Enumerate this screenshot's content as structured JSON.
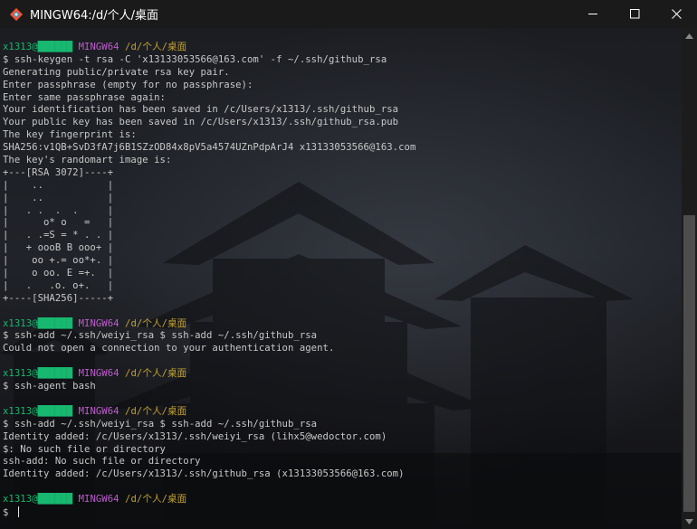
{
  "window": {
    "title": "MINGW64:/d/个人/桌面",
    "icon": "git-bash-icon",
    "controls": [
      "minimize-icon",
      "maximize-icon",
      "close-icon"
    ]
  },
  "prompt": {
    "user": "x1313@",
    "host_block": "██████",
    "mingw": "MINGW64",
    "path": "/d/个人/桌面"
  },
  "colors": {
    "user": "#17b86f",
    "mingw": "#bf5ccf",
    "path": "#c0a033",
    "text": "#c8c8c8"
  },
  "terminal": {
    "lines": [
      {
        "type": "prompt"
      },
      {
        "type": "text",
        "text": "$ ssh-keygen -t rsa -C 'x13133053566@163.com' -f ~/.ssh/github_rsa"
      },
      {
        "type": "text",
        "text": "Generating public/private rsa key pair."
      },
      {
        "type": "text",
        "text": "Enter passphrase (empty for no passphrase):"
      },
      {
        "type": "text",
        "text": "Enter same passphrase again:"
      },
      {
        "type": "text",
        "text": "Your identification has been saved in /c/Users/x1313/.ssh/github_rsa"
      },
      {
        "type": "text",
        "text": "Your public key has been saved in /c/Users/x1313/.ssh/github_rsa.pub"
      },
      {
        "type": "text",
        "text": "The key fingerprint is:"
      },
      {
        "type": "text",
        "text": "SHA256:v1QB+SvD3fA7j6B1SZzOD84x8pV5a4574UZnPdpArJ4 x13133053566@163.com"
      },
      {
        "type": "text",
        "text": "The key's randomart image is:"
      },
      {
        "type": "text",
        "text": "+---[RSA 3072]----+"
      },
      {
        "type": "text",
        "text": "|    ..           |"
      },
      {
        "type": "text",
        "text": "|    ..           |"
      },
      {
        "type": "text",
        "text": "|   . .  .  .     |"
      },
      {
        "type": "text",
        "text": "|      o* o   =   |"
      },
      {
        "type": "text",
        "text": "|   . .=S = * . . |"
      },
      {
        "type": "text",
        "text": "|   + oooB B ooo+ |"
      },
      {
        "type": "text",
        "text": "|    oo +.= oo*+. |"
      },
      {
        "type": "text",
        "text": "|    o oo. E =+.  |"
      },
      {
        "type": "text",
        "text": "|   .   .o. o+.   |"
      },
      {
        "type": "text",
        "text": "+----[SHA256]-----+"
      },
      {
        "type": "blank"
      },
      {
        "type": "prompt"
      },
      {
        "type": "text",
        "text": "$ ssh-add ~/.ssh/weiyi_rsa $ ssh-add ~/.ssh/github_rsa"
      },
      {
        "type": "text",
        "text": "Could not open a connection to your authentication agent."
      },
      {
        "type": "blank"
      },
      {
        "type": "prompt"
      },
      {
        "type": "text",
        "text": "$ ssh-agent bash"
      },
      {
        "type": "blank"
      },
      {
        "type": "prompt"
      },
      {
        "type": "text",
        "text": "$ ssh-add ~/.ssh/weiyi_rsa $ ssh-add ~/.ssh/github_rsa"
      },
      {
        "type": "text",
        "text": "Identity added: /c/Users/x1313/.ssh/weiyi_rsa (lihx5@wedoctor.com)"
      },
      {
        "type": "text",
        "text": "$: No such file or directory"
      },
      {
        "type": "text",
        "text": "ssh-add: No such file or directory"
      },
      {
        "type": "text",
        "text": "Identity added: /c/Users/x1313/.ssh/github_rsa (x13133053566@163.com)"
      },
      {
        "type": "blank"
      },
      {
        "type": "prompt"
      },
      {
        "type": "input",
        "text": "$ "
      }
    ]
  }
}
